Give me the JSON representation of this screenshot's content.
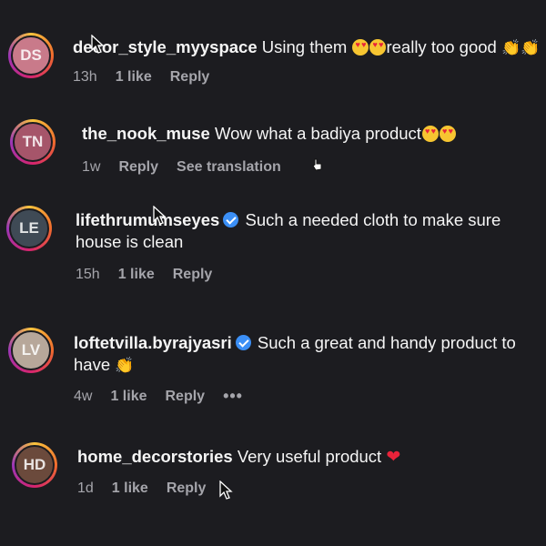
{
  "comments": [
    {
      "username": "decor_style_myyspace",
      "text": "Using them",
      "text_after": "really too good",
      "time": "13h",
      "likes": "1 like",
      "reply": "Reply",
      "avatar_initials": "DS",
      "avatar_color": "#c97a8a"
    },
    {
      "username": "the_nook_muse",
      "text": "Wow what a badiya product",
      "time": "1w",
      "reply": "Reply",
      "translation": "See translation",
      "avatar_initials": "TN",
      "avatar_color": "#a6556a"
    },
    {
      "username": "lifethrumumseyes",
      "text": "Such a needed cloth to make sure house is clean",
      "time": "15h",
      "likes": "1 like",
      "reply": "Reply",
      "avatar_initials": "LE",
      "avatar_color": "#3f4a55"
    },
    {
      "username": "loftetvilla.byrajyasri",
      "text": "Such a great and handy product to have",
      "time": "4w",
      "likes": "1 like",
      "reply": "Reply",
      "more": "•••",
      "avatar_initials": "LV",
      "avatar_color": "#b7a79a"
    },
    {
      "username": "home_decorstories",
      "text": "Very useful product",
      "time": "1d",
      "likes": "1 like",
      "reply": "Reply",
      "avatar_initials": "HD",
      "avatar_color": "#6b4a3c"
    }
  ],
  "colors": {
    "background": "#1c1c20",
    "meta_text": "#a5a5ab",
    "verified_blue": "#3b8ff6"
  }
}
